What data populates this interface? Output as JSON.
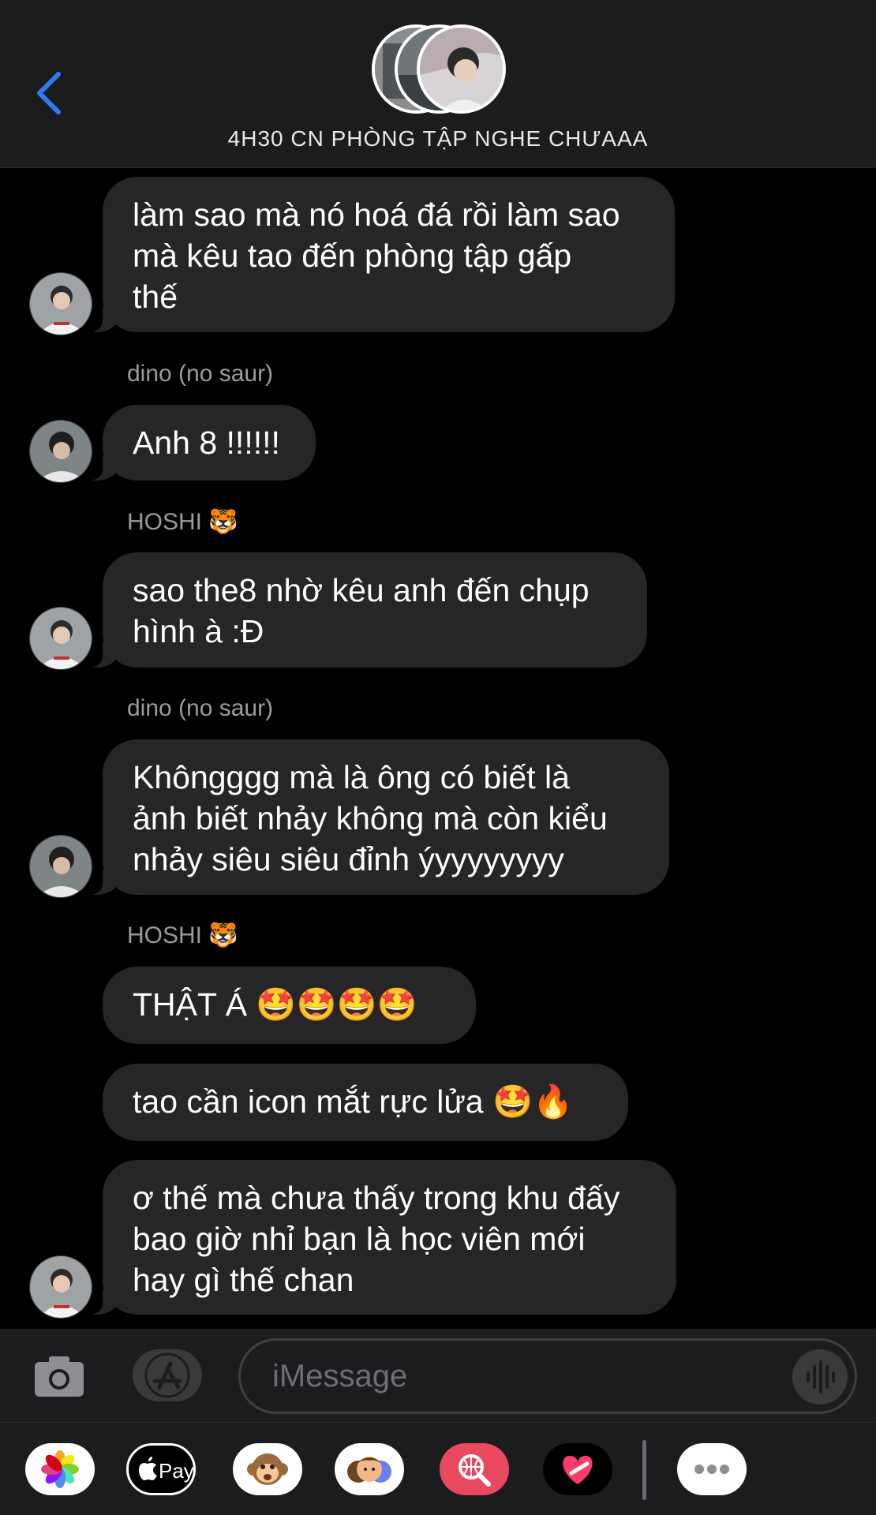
{
  "header": {
    "back_icon": "chevron-left-icon",
    "group_title": "4H30 CN PHÒNG TẬP NGHE CHƯAAA",
    "accent_color": "#2f7bf6"
  },
  "messages": [
    {
      "text_lines": [
        "làm sao mà nó hoá đá rồi làm sao",
        "mà kêu tao đến phòng tập gấp",
        "thế"
      ]
    },
    {
      "sender": "dino (no saur)",
      "text_lines": [
        "Anh 8 !!!!!!"
      ]
    },
    {
      "sender": "HOSHI 🐯",
      "text_lines": [
        "sao the8 nhờ kêu anh đến chụp",
        "hình à :Đ"
      ]
    },
    {
      "sender": "dino (no saur)",
      "text_lines": [
        "Khôngggg mà là ông có biết là",
        "ảnh biết nhảy không mà còn kiểu",
        "nhảy siêu siêu đỉnh ýyyyyyyyy"
      ]
    },
    {
      "sender": "HOSHI 🐯",
      "text_lines": [
        "THẬT Á 🤩🤩🤩🤩"
      ]
    },
    {
      "text_lines": [
        "tao cần icon mắt rực lửa 🤩🔥"
      ]
    },
    {
      "text_lines": [
        "ơ thế mà chưa thấy trong khu đấy",
        "bao giờ nhỉ bạn là học viên mới",
        "hay gì thế chan"
      ]
    }
  ],
  "input_bar": {
    "placeholder": "iMessage",
    "camera_icon": "camera-icon",
    "apps_icon": "app-store-icon",
    "audio_icon": "audio-waveform-icon"
  },
  "app_drawer": [
    {
      "name": "photos-app-icon"
    },
    {
      "name": "apple-pay-icon",
      "label": "Pay"
    },
    {
      "name": "monkey-animoji-icon"
    },
    {
      "name": "memoji-icon"
    },
    {
      "name": "images-search-icon"
    },
    {
      "name": "digital-touch-icon"
    },
    {
      "name": "more-apps-icon"
    }
  ]
}
